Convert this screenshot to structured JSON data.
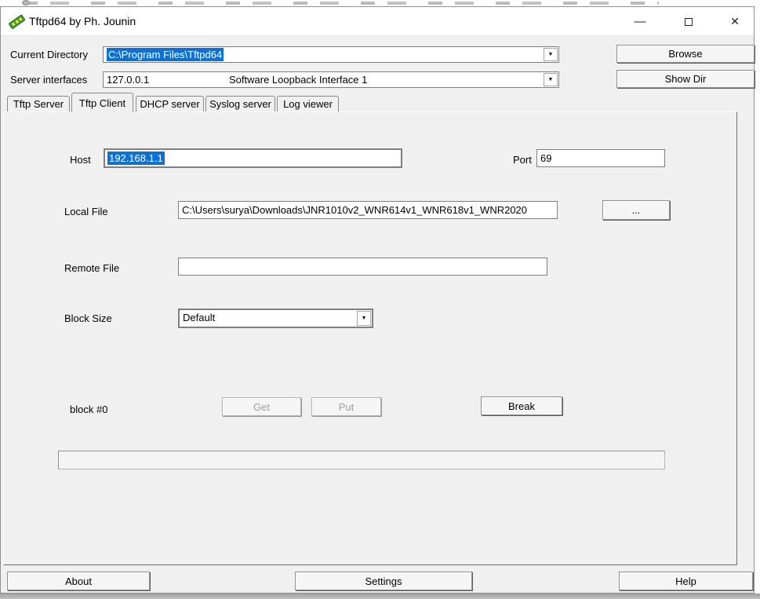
{
  "window": {
    "title": "Tftpd64 by Ph. Jounin",
    "controls": {
      "minimize": "—",
      "close": "✕"
    }
  },
  "header": {
    "current_directory": {
      "label": "Current Directory",
      "value": "C:\\Program Files\\Tftpd64"
    },
    "server_interfaces": {
      "label": "Server interfaces",
      "address": "127.0.0.1",
      "interface_name": "Software Loopback Interface 1"
    },
    "browse_button": "Browse",
    "show_dir_button": "Show Dir"
  },
  "tabs": [
    {
      "label": "Tftp Server",
      "active": false
    },
    {
      "label": "Tftp Client",
      "active": true
    },
    {
      "label": "DHCP server",
      "active": false
    },
    {
      "label": "Syslog server",
      "active": false
    },
    {
      "label": "Log viewer",
      "active": false
    }
  ],
  "tftp_client": {
    "host_label": "Host",
    "host_value": "192.168.1.1",
    "port_label": "Port",
    "port_value": "69",
    "local_file_label": "Local File",
    "local_file_value": "C:\\Users\\surya\\Downloads\\JNR1010v2_WNR614v1_WNR618v1_WNR2020",
    "local_file_browse": "...",
    "remote_file_label": "Remote File",
    "remote_file_value": "",
    "block_size_label": "Block Size",
    "block_size_value": "Default",
    "status_text": "block #0",
    "get_button": "Get",
    "put_button": "Put",
    "break_button": "Break",
    "progress_percent": 0
  },
  "footer": {
    "about_button": "About",
    "settings_button": "Settings",
    "help_button": "Help"
  },
  "icons": {
    "dropdown_arrow": "▼"
  },
  "colors": {
    "selection_blue": "#0b72d4",
    "window_bg": "#f0f0f0",
    "titlebar_bg": "#ffffff",
    "disabled_text": "#9f9f9f"
  }
}
